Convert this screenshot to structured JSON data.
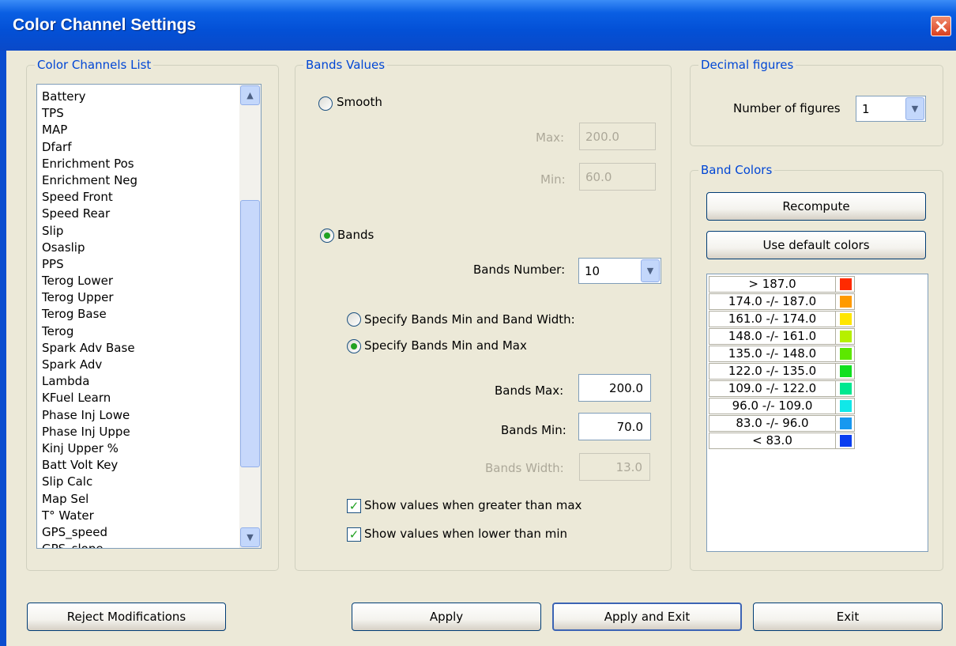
{
  "window": {
    "title": "Color Channel Settings"
  },
  "channels": {
    "group_title": "Color Channels List",
    "items": [
      "Battery",
      "TPS",
      "MAP",
      "Dfarf",
      "Enrichment Pos",
      "Enrichment Neg",
      "Speed Front",
      "Speed Rear",
      "Slip",
      "Osaslip",
      "PPS",
      "Terog Lower",
      "Terog Upper",
      "Terog Base",
      "Terog",
      "Spark Adv Base",
      "Spark Adv",
      "Lambda",
      "KFuel Learn",
      "Phase Inj Lowe",
      "Phase Inj Uppe",
      "Kinj Upper %",
      "Batt Volt Key",
      "Slip Calc",
      "Map Sel",
      "T° Water",
      "GPS_speed",
      "GPS_slope"
    ]
  },
  "bands_values": {
    "group_title": "Bands Values",
    "smooth_label": "Smooth",
    "max_label": "Max:",
    "max_value": "200.0",
    "min_label": "Min:",
    "min_value": "60.0",
    "bands_label": "Bands",
    "bands_number_label": "Bands Number:",
    "bands_number_value": "10",
    "specify_width_label": "Specify Bands Min and Band Width:",
    "specify_max_label": "Specify Bands Min and Max",
    "bands_max_label": "Bands Max:",
    "bands_max_value": "200.0",
    "bands_min_label": "Bands Min:",
    "bands_min_value": "70.0",
    "bands_width_label": "Bands Width:",
    "bands_width_value": "13.0",
    "show_greater_label": "Show values when greater than max",
    "show_lower_label": "Show values when lower than min"
  },
  "decimal": {
    "group_title": "Decimal figures",
    "number_label": "Number of figures",
    "number_value": "1"
  },
  "band_colors": {
    "group_title": "Band Colors",
    "recompute_label": "Recompute",
    "default_colors_label": "Use default colors",
    "rows": [
      {
        "label": "> 187.0",
        "color": "#ff2a00"
      },
      {
        "label": "174.0 -/- 187.0",
        "color": "#ff9a00"
      },
      {
        "label": "161.0 -/- 174.0",
        "color": "#ffe600"
      },
      {
        "label": "148.0 -/- 161.0",
        "color": "#b6f000"
      },
      {
        "label": "135.0 -/- 148.0",
        "color": "#5ce800"
      },
      {
        "label": "122.0 -/- 135.0",
        "color": "#10e020"
      },
      {
        "label": "109.0 -/- 122.0",
        "color": "#00e890"
      },
      {
        "label": "96.0 -/- 109.0",
        "color": "#10e8e8"
      },
      {
        "label": "83.0 -/- 96.0",
        "color": "#1898f0"
      },
      {
        "label": "< 83.0",
        "color": "#0a3ef0"
      }
    ]
  },
  "footer": {
    "reject_label": "Reject Modifications",
    "apply_label": "Apply",
    "apply_exit_label": "Apply and Exit",
    "exit_label": "Exit"
  }
}
